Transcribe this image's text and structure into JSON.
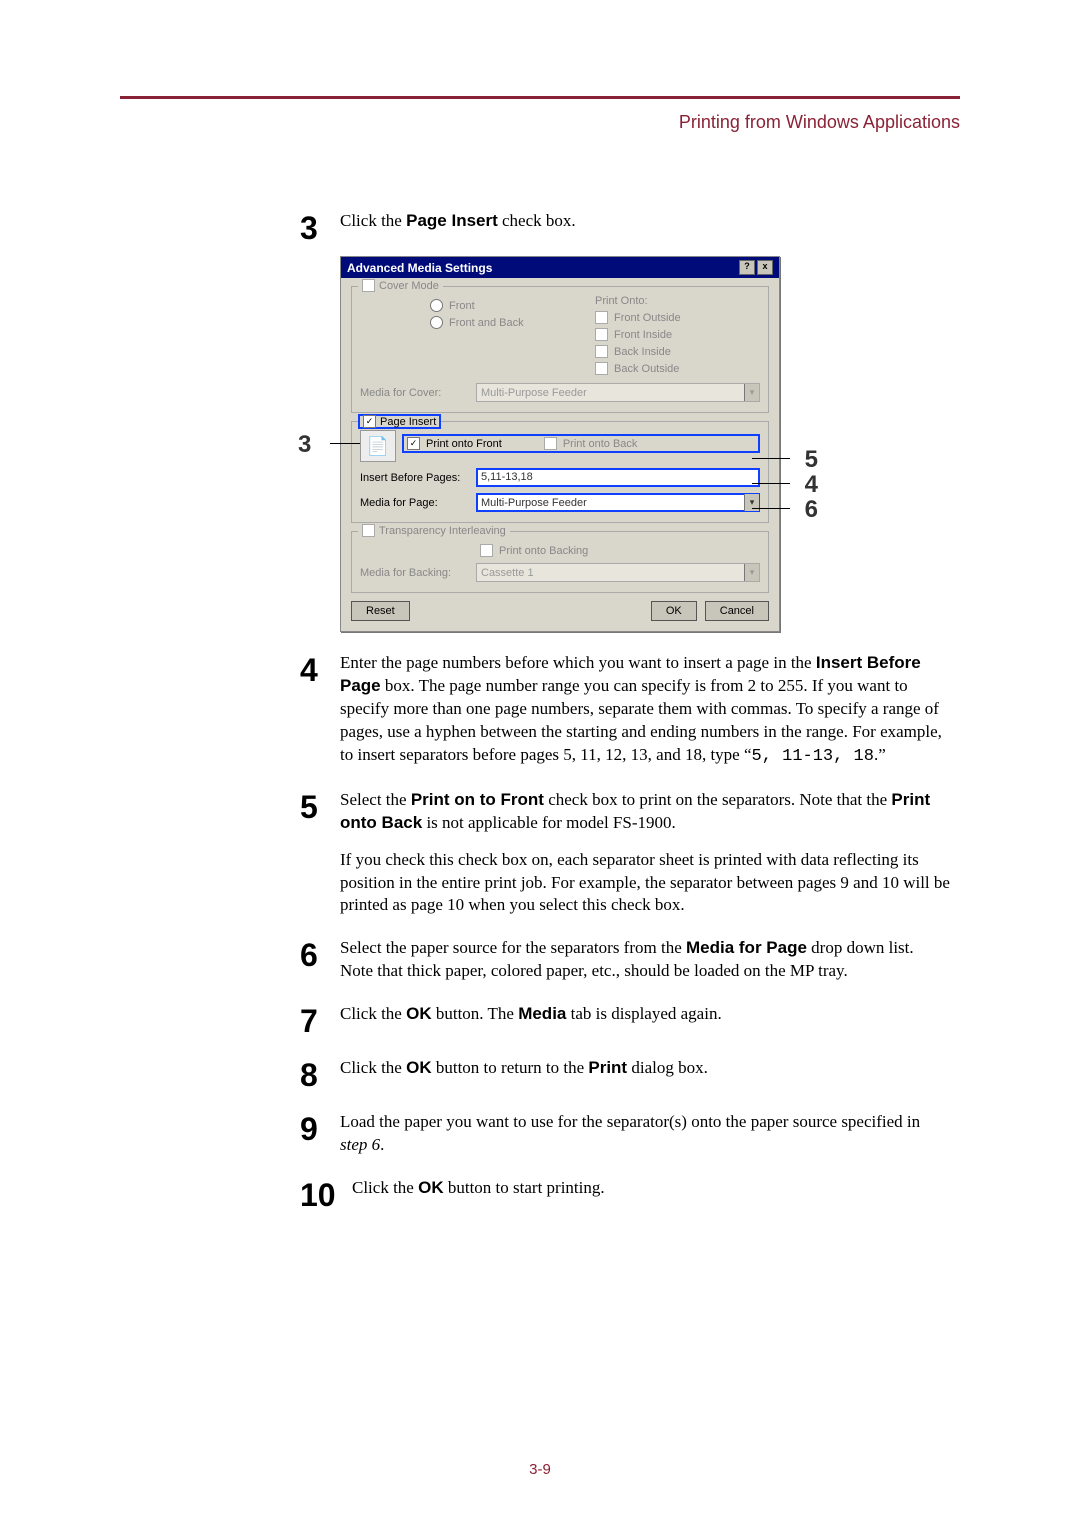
{
  "header": {
    "section": "Printing from Windows Applications"
  },
  "footer": {
    "pagenum": "3-9"
  },
  "steps": {
    "s3": {
      "num": "3",
      "pre": "Click the ",
      "b1": "Page Insert",
      "post": " check box."
    },
    "s4": {
      "num": "4",
      "t1": "Enter the page numbers before which you want to insert a page in the ",
      "b1": "Insert Before Page",
      "t2": " box. The page number range you can specify is from 2 to 255. If you want to specify more than one page numbers, separate them with commas. To specify a range of pages, use a hyphen between the starting and ending numbers in the range. For example, to insert separators before pages 5, 11, 12, 13, and 18, type “",
      "code": "5, 11-13, 18",
      "t3": ".”"
    },
    "s5": {
      "num": "5",
      "t1": "Select the ",
      "b1": "Print on to Front",
      "t2": " check box to print on the separators. Note that the ",
      "b2": "Print onto Back",
      "t3": " is not applicable for model FS-1900.",
      "para2": "If you check this check box on, each separator sheet is printed with data reflecting its position in the entire print job. For example, the separator between pages 9 and 10 will be printed as page 10 when you select this check box."
    },
    "s6": {
      "num": "6",
      "t1": "Select the paper source for the separators from the ",
      "b1": "Media for Page",
      "t2": " drop down list. Note that thick paper, colored paper, etc., should be loaded on the MP tray."
    },
    "s7": {
      "num": "7",
      "t1": "Click the ",
      "b1": "OK",
      "t2": " button. The ",
      "b2": "Media",
      "t3": " tab is displayed again."
    },
    "s8": {
      "num": "8",
      "t1": "Click the ",
      "b1": "OK",
      "t2": " button to return to the ",
      "b2": "Print",
      "t3": " dialog box."
    },
    "s9": {
      "num": "9",
      "t1": "Load the paper you want to use for the separator(s) onto the paper source specified in ",
      "i1": "step 6",
      "t2": "."
    },
    "s10": {
      "num": "10",
      "t1": "Click the ",
      "b1": "OK",
      "t2": " button to start printing."
    }
  },
  "dialog": {
    "title": "Advanced Media Settings",
    "cover": {
      "legend": "Cover Mode",
      "front": "Front",
      "frontback": "Front and Back",
      "printonto": "Print Onto:",
      "fo": "Front Outside",
      "fi": "Front Inside",
      "bi": "Back Inside",
      "bo": "Back Outside",
      "mediaLabel": "Media for Cover:",
      "mediaValue": "Multi-Purpose Feeder"
    },
    "insert": {
      "legend": "Page Insert",
      "printFront": "Print onto Front",
      "printBack": "Print onto Back",
      "beforeLabel": "Insert Before Pages:",
      "beforeValue": "5,11-13,18",
      "mediaLabel": "Media for Page:",
      "mediaValue": "Multi-Purpose Feeder"
    },
    "trans": {
      "legend": "Transparency Interleaving",
      "printBacking": "Print onto Backing",
      "mediaLabel": "Media for Backing:",
      "mediaValue": "Cassette 1"
    },
    "buttons": {
      "reset": "Reset",
      "ok": "OK",
      "cancel": "Cancel"
    },
    "callouts": {
      "left3": "3",
      "r5": "5",
      "r4": "4",
      "r6": "6"
    }
  }
}
